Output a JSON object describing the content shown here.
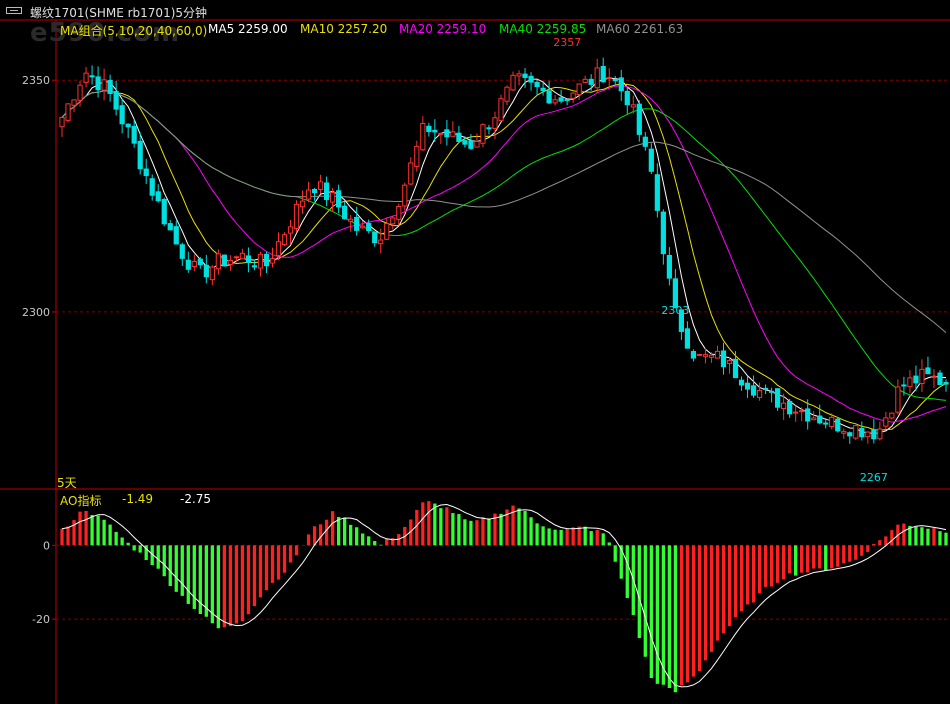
{
  "header": {
    "title": "螺纹1701(SHME rb1701)5分钟",
    "watermark": "e590.com"
  },
  "ma_legend": [
    {
      "label": "MA组合(5,10,20,40,60,0)",
      "color": "#e8e000"
    },
    {
      "label": "MA5 2259.00",
      "color": "#ffffff"
    },
    {
      "label": "MA10 2257.20",
      "color": "#e8e000"
    },
    {
      "label": "MA20 2259.10",
      "color": "#ff00ff"
    },
    {
      "label": "MA40 2259.85",
      "color": "#00e000"
    },
    {
      "label": "MA60 2261.63",
      "color": "#909090"
    }
  ],
  "lower_pane": {
    "period_label": "5天",
    "indicator_name": "AO指标",
    "value1": "-1.49",
    "value2": "-2.75",
    "value1_color": "#e8e000",
    "value2_color": "#ffffff"
  },
  "colors": {
    "up": "#ff3030",
    "down": "#00e0e0",
    "grid": "#800000",
    "axis": "#c00000",
    "ao_up": "#ff2020",
    "ao_down": "#30ff30"
  },
  "chart_data": [
    {
      "type": "candlestick",
      "title": "螺纹1701(SHME rb1701)5分钟",
      "y_ticks": [
        2300,
        2350
      ],
      "ylim": [
        2262,
        2363
      ],
      "annotations": [
        {
          "text": "2357",
          "value": 2357,
          "kind": "high"
        },
        {
          "text": "2303",
          "value": 2303,
          "kind": "low"
        },
        {
          "text": "2267",
          "value": 2267,
          "kind": "low"
        }
      ],
      "key_closes": [
        2342,
        2352,
        2348,
        2338,
        2326,
        2315,
        2308,
        2311,
        2312,
        2310,
        2319,
        2328,
        2324,
        2318,
        2316,
        2326,
        2340,
        2338,
        2336,
        2342,
        2350,
        2348,
        2346,
        2349,
        2352,
        2346,
        2330,
        2300,
        2290,
        2290,
        2286,
        2282,
        2280,
        2278,
        2276,
        2275,
        2274,
        2284,
        2286,
        2285
      ],
      "series": [
        {
          "name": "MA5",
          "value": 2259.0
        },
        {
          "name": "MA10",
          "value": 2257.2
        },
        {
          "name": "MA20",
          "value": 2259.1
        },
        {
          "name": "MA40",
          "value": 2259.85
        },
        {
          "name": "MA60",
          "value": 2261.63
        }
      ]
    },
    {
      "type": "bar",
      "title": "AO指标",
      "y_ticks": [
        0,
        -20
      ],
      "ylim": [
        -43,
        15
      ],
      "key_values": [
        4,
        10,
        6,
        0,
        -5,
        -12,
        -18,
        -23,
        -20,
        -12,
        -6,
        4,
        9,
        5,
        0,
        4,
        12,
        10,
        6,
        8,
        11,
        6,
        4,
        5,
        3,
        -15,
        -36,
        -40,
        -35,
        -25,
        -18,
        -12,
        -8,
        -7,
        -6,
        -4,
        1,
        6,
        5,
        4
      ],
      "signal_last": -2.75,
      "value_last": -1.49
    }
  ]
}
